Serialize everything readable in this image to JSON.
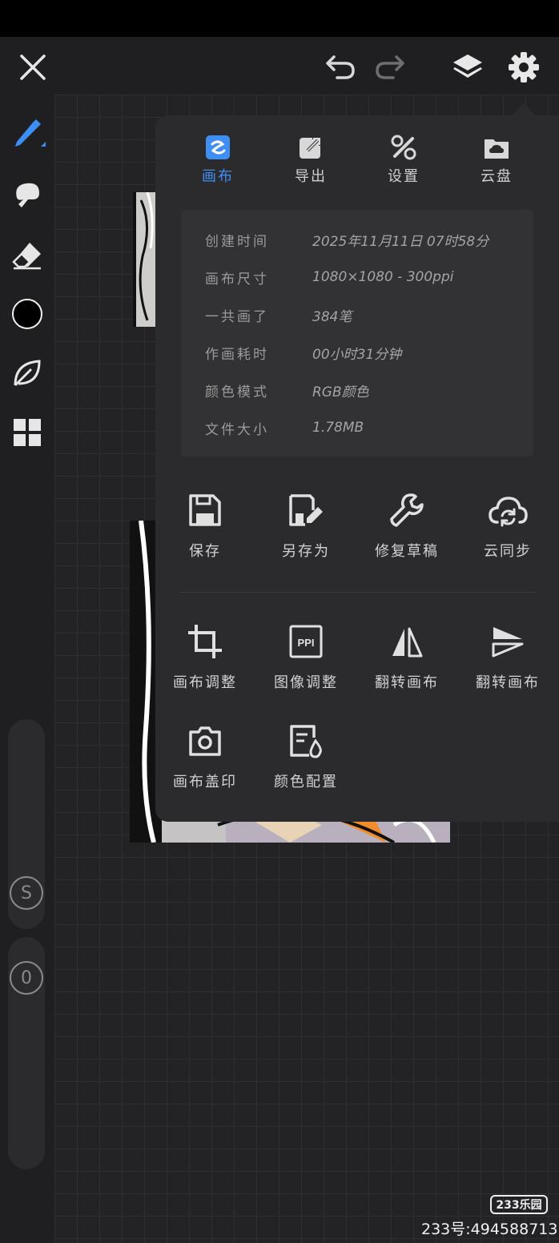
{
  "topbar": {
    "close_icon": "close-icon",
    "undo_icon": "undo-icon",
    "redo_icon": "redo-icon",
    "layers_icon": "layers-icon",
    "settings_icon": "gear-icon"
  },
  "sidebar": {
    "tools": [
      "brush-icon",
      "smudge-icon",
      "eraser-icon",
      "color-swatch",
      "leaf-icon",
      "grid-icon"
    ],
    "current_color": "#000000",
    "size_slider_label": "S",
    "opacity_slider_label": "0"
  },
  "panel": {
    "tabs": [
      {
        "label": "画布",
        "icon": "canvas-icon",
        "active": true
      },
      {
        "label": "导出",
        "icon": "export-icon",
        "active": false
      },
      {
        "label": "设置",
        "icon": "settings-tools-icon",
        "active": false
      },
      {
        "label": "云盘",
        "icon": "cloud-drive-icon",
        "active": false
      }
    ],
    "info": [
      {
        "key": "创建时间",
        "value": "2025年11月11日 07时58分"
      },
      {
        "key": "画布尺寸",
        "value": "1080×1080 - 300ppi"
      },
      {
        "key": "一共画了",
        "value": "384笔"
      },
      {
        "key": "作画耗时",
        "value": "00小时31分钟"
      },
      {
        "key": "颜色模式",
        "value": "RGB颜色"
      },
      {
        "key": "文件大小",
        "value": "1.78MB"
      }
    ],
    "actions_row1": [
      {
        "label": "保存",
        "icon": "save-icon"
      },
      {
        "label": "另存为",
        "icon": "save-as-icon"
      },
      {
        "label": "修复草稿",
        "icon": "wrench-icon"
      },
      {
        "label": "云同步",
        "icon": "cloud-sync-icon"
      }
    ],
    "actions_row2": [
      {
        "label": "画布调整",
        "icon": "crop-icon"
      },
      {
        "label": "图像调整",
        "icon": "ppi-icon",
        "badge": "PPI"
      },
      {
        "label": "翻转画布",
        "icon": "flip-horizontal-icon"
      },
      {
        "label": "翻转画布",
        "icon": "flip-vertical-icon"
      }
    ],
    "actions_row3": [
      {
        "label": "画布盖印",
        "icon": "camera-icon"
      },
      {
        "label": "颜色配置",
        "icon": "color-config-icon"
      }
    ]
  },
  "accent_color": "#3f8ef5",
  "watermark": {
    "logo": "233乐园",
    "text": "233号:494588713"
  }
}
